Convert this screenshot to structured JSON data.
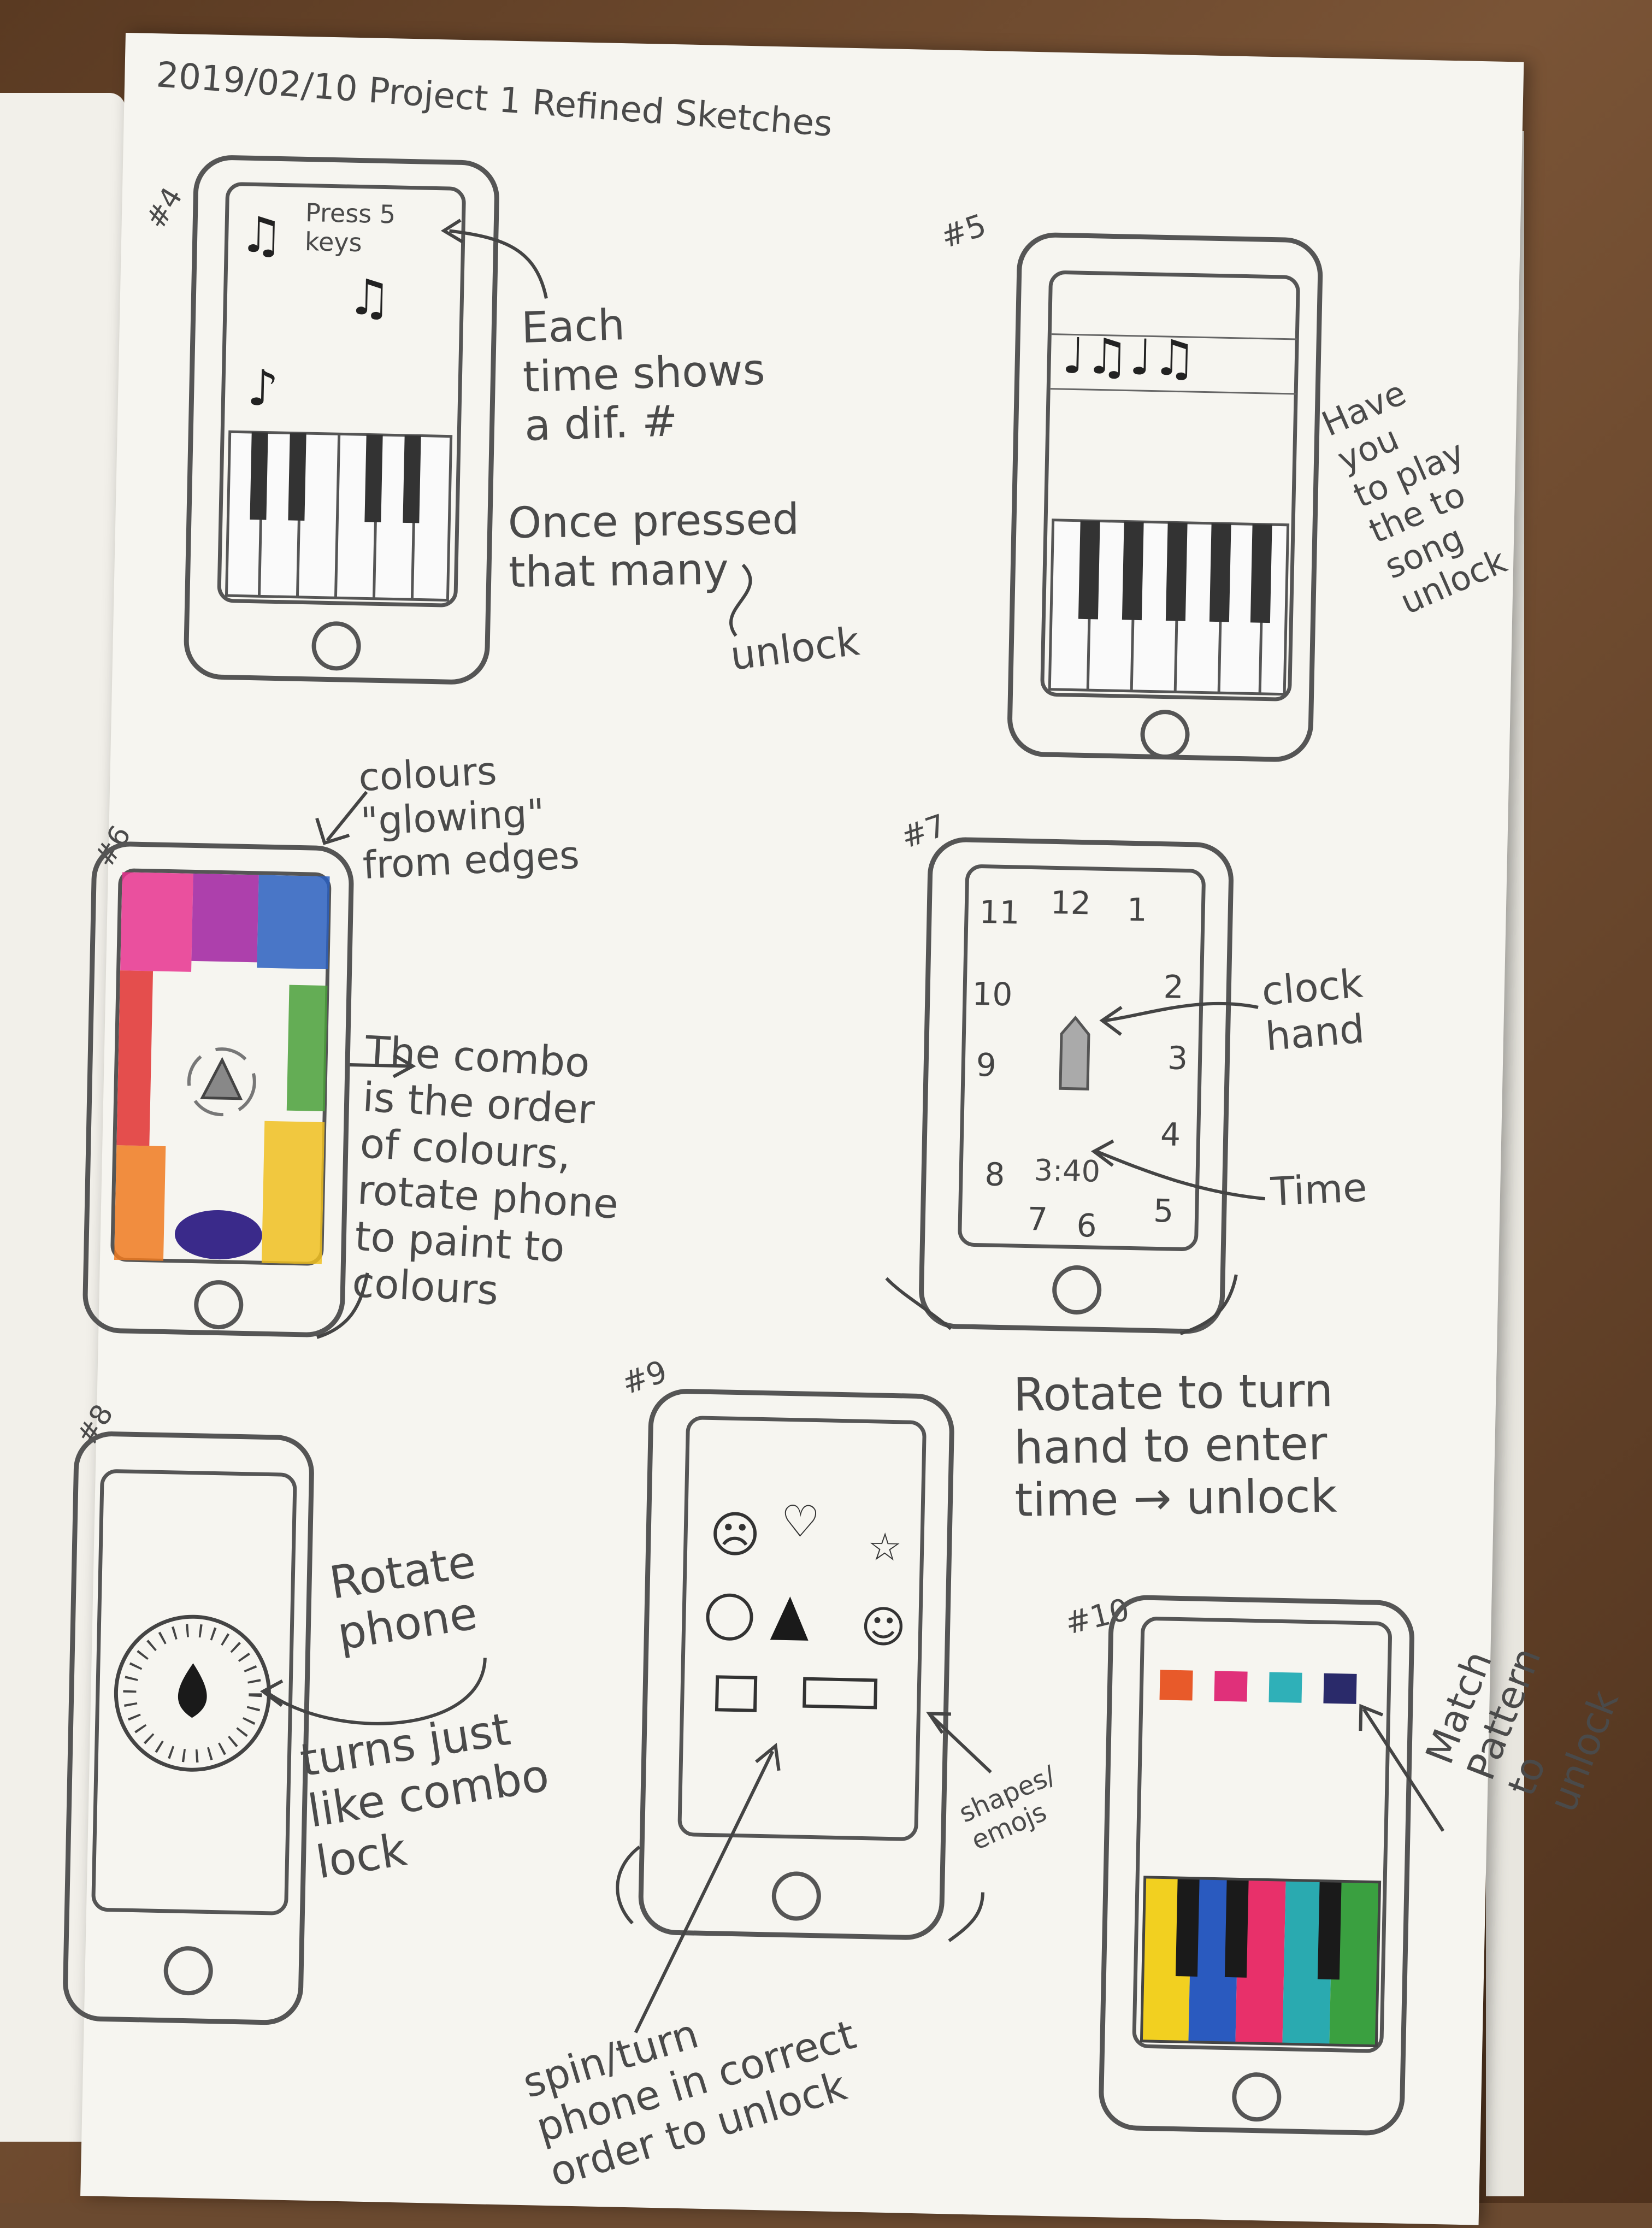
{
  "page": {
    "header": "2019/02/10 Project 1 Refined Sketches"
  },
  "sketches": {
    "s4": {
      "number": "#4",
      "screen_text": "Press 5\nkeys",
      "note_a": "Each\ntime shows\na dif. #",
      "note_b": "Once pressed\nthat many",
      "note_c": "unlock"
    },
    "s5": {
      "number": "#5",
      "note": "Have you\nto play\nthe to\nsong\nunlock"
    },
    "s6": {
      "number": "#6",
      "note_top": "colours\n\"glowing\"\nfrom edges",
      "note_side": "The combo\nis the order\nof colours,\nrotate phone\nto paint to\ncolours",
      "colors": [
        "#e8338f",
        "#a020a0",
        "#2a5fbf",
        "#4aa03a",
        "#f0c020",
        "#f07a20",
        "#e03030",
        "#3a2a8a"
      ]
    },
    "s7": {
      "number": "#7",
      "dial": [
        "12",
        "1",
        "2",
        "3",
        "4",
        "5",
        "6",
        "7",
        "8",
        "9",
        "10",
        "11"
      ],
      "time": "3:40",
      "label_hand": "clock\nhand",
      "label_time": "Time",
      "note": "Rotate  to turn\nhand to enter\ntime → unlock"
    },
    "s8": {
      "number": "#8",
      "note_a": "Rotate\nphone",
      "note_b": "turns just\nlike combo\nlock"
    },
    "s9": {
      "number": "#9",
      "label_shapes": "shapes/\nemojs",
      "note": "spin/turn\nphone in correct\norder to unlock"
    },
    "s10": {
      "number": "#10",
      "note": "Match\nPattern\nto\nunlock",
      "pattern_colors": [
        "#e85a2a",
        "#e0307a",
        "#2fb0b8",
        "#2a2a6a"
      ],
      "key_colors": [
        "#f2d020",
        "#2a5abf",
        "#e8306a",
        "#2aaab0",
        "#3aa040"
      ]
    }
  }
}
